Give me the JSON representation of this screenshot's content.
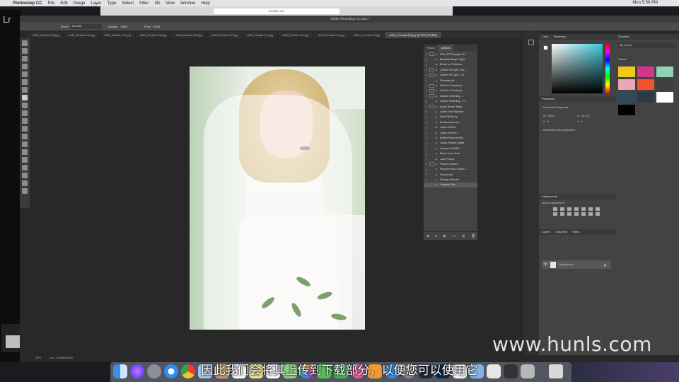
{
  "menubar": {
    "apple": "",
    "items": [
      "Photoshop CC",
      "File",
      "Edit",
      "Image",
      "Layer",
      "Type",
      "Select",
      "Filter",
      "3D",
      "View",
      "Window",
      "Help"
    ],
    "clock": "Mon 5:59 PM"
  },
  "browser": {
    "url": "Envato, Inc"
  },
  "lightroom": {
    "label": "Lr"
  },
  "photoshop": {
    "title": "Adobe Photoshop CC 2017",
    "options": {
      "mode_label": "Mode:",
      "mode_value": "Normal",
      "opacity_label": "Opacity:",
      "opacity_value": "100%",
      "flow_label": "Flow:",
      "flow_value": "100%"
    },
    "tabs": [
      "A&M_Details-103.jpg",
      "A&M_Details-106.jpg",
      "A&M_Details-107.jpg",
      "A&M_Details-108.jpg",
      "A&M_Details-109.jpg",
      "A&M_Details-110.jpg",
      "A&M_Details-111.jpg",
      "A&M_Details-112.jpg",
      "A&M_Details-113.jpg",
      "A&M_Formals-34.jpg",
      "A&M_Formals-50.jpg @ 33% (RGB/8)"
    ],
    "status": "33%",
    "status_doc": "Doc: 34.6M/34.6M"
  },
  "actions_panel": {
    "tabs": [
      "History",
      "Actions"
    ],
    "rows": [
      {
        "label": "PFK JPP Designer E...",
        "checked": true,
        "dialog": true,
        "folder": true
      },
      {
        "label": "Beautiful Bright Light",
        "checked": true,
        "dialog": false
      },
      {
        "label": "Brush on Softness",
        "checked": true,
        "dialog": false
      },
      {
        "label": "Center Fill Light- Ver...",
        "checked": true,
        "dialog": true
      },
      {
        "label": "Center Fill Light- Ho...",
        "checked": true,
        "dialog": true
      },
      {
        "label": "Filmesquide",
        "checked": true,
        "dialog": false
      },
      {
        "label": "Fixit! for Facebook...",
        "checked": true,
        "dialog": true
      },
      {
        "label": "Fixit! for Facebook...",
        "checked": true,
        "dialog": true
      },
      {
        "label": "Instant Softening -...",
        "checked": true,
        "dialog": true
      },
      {
        "label": "Instant Softening - H...",
        "checked": true,
        "dialog": false
      },
      {
        "label": "Apple Brown Betty",
        "checked": true,
        "dialog": true
      },
      {
        "label": "Julie's Eye Brandon",
        "checked": true,
        "dialog": false
      },
      {
        "label": "Red Rift Spray",
        "checked": true,
        "dialog": false
      },
      {
        "label": "Burlap and Lace",
        "checked": true,
        "dialog": false
      },
      {
        "label": "Julie's Secret",
        "checked": true,
        "dialog": false
      },
      {
        "label": "Julie's Secret 2",
        "checked": true,
        "dialog": false
      },
      {
        "label": "Boiled Peanuts BW",
        "checked": true,
        "dialog": false
      },
      {
        "label": "Julie's Simple Digita...",
        "checked": true,
        "dialog": false
      },
      {
        "label": "Honey Child BW",
        "checked": true,
        "dialog": false
      },
      {
        "label": "Bless Your Heart",
        "checked": true,
        "dialog": false
      },
      {
        "label": "Just Peachy",
        "checked": true,
        "dialog": false
      },
      {
        "label": "Peach Cobbler",
        "checked": true,
        "dialog": true
      },
      {
        "label": "Peaches and Cream -...",
        "checked": true,
        "dialog": false
      },
      {
        "label": "Rosewood",
        "checked": true,
        "dialog": false
      },
      {
        "label": "Vintage Warmth",
        "checked": true,
        "dialog": false
      },
      {
        "label": "Creamy Skin",
        "checked": true,
        "dialog": false,
        "selected": true
      }
    ]
  },
  "color_panel": {
    "tabs": [
      "Color",
      "Swatches"
    ]
  },
  "properties_panel": {
    "title": "Properties",
    "subtitle": "Document Properties",
    "w_label": "W:",
    "w_value": "8.8 in",
    "h_label": "H:",
    "h_value": "16.2 in",
    "x_label": "X:",
    "x_value": "0",
    "y_label": "Y:",
    "y_value": "0",
    "resolution": "Resolution: 300 pixels/inch"
  },
  "adjustments_panel": {
    "title": "Adjustments",
    "subtitle": "Add an adjustment"
  },
  "layers_panel": {
    "tabs": [
      "Layers",
      "Channels",
      "Paths"
    ],
    "layer_name": "Background"
  },
  "libraries_panel": {
    "title": "Libraries",
    "library": "My Library",
    "section": "Colors",
    "swatches": [
      "#f3c81c",
      "#d6338a",
      "#8fd3b6",
      "#e8a8b8",
      "#f2522c",
      "#3e3e3e",
      "#2f4a59",
      "#2b3b45",
      "#ffffff",
      "#000000"
    ]
  },
  "subtitle": "因此我们会将其上传到下载部分，以便您可以使用它",
  "watermark": "www.hunls.com",
  "colors": {
    "menubar": "#e4e4e6",
    "panel": "#434343",
    "workspace": "#282828",
    "accent": "#3fc7d6"
  }
}
